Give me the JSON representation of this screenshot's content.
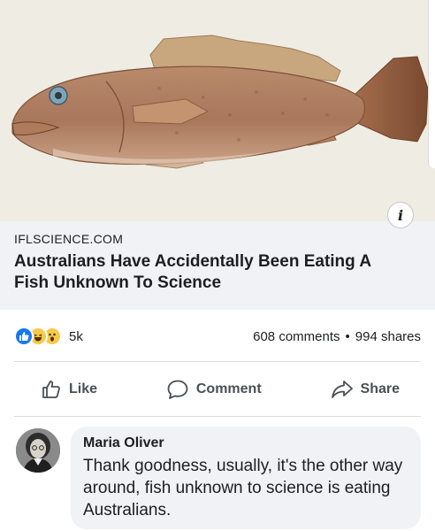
{
  "post": {
    "domain": "IFLSCIENCE.COM",
    "headline": "Australians Have Accidentally Been Eating A Fish Unknown To Science",
    "info_icon": "info-icon"
  },
  "stats": {
    "reaction_icons": [
      "like-icon",
      "haha-icon",
      "wow-icon"
    ],
    "reaction_count": "5k",
    "comments": "608 comments",
    "separator": "•",
    "shares": "994 shares"
  },
  "actions": {
    "like": "Like",
    "comment": "Comment",
    "share": "Share"
  },
  "comment": {
    "author": "Maria Oliver",
    "text": "Thank goodness, usually, it's the other way around, fish unknown to science is eating Australians."
  },
  "colors": {
    "link_box_bg": "#f0f2f5",
    "like_blue": "#1877f2",
    "action_gray": "#4b4f56"
  }
}
